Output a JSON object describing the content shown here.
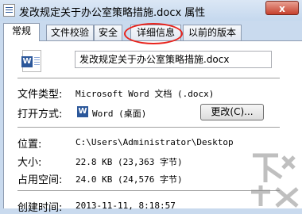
{
  "window": {
    "title": "发改规定关于办公室策略措施.docx 属性",
    "close_label": "x"
  },
  "tabs": [
    {
      "label": "常规"
    },
    {
      "label": "文件校验"
    },
    {
      "label": "安全"
    },
    {
      "label": "详细信息"
    },
    {
      "label": "以前的版本"
    }
  ],
  "active_tab": "常规",
  "file": {
    "name": "发改规定关于办公室策略措施.docx"
  },
  "fields": {
    "type_label": "文件类型:",
    "type_value": "Microsoft Word 文档 (.docx)",
    "open_label": "打开方式:",
    "open_value": "Word (桌面)",
    "change_button": "更改(C)...",
    "location_label": "位置:",
    "location_value": "C:\\Users\\Administrator\\Desktop",
    "size_label": "大小:",
    "size_value": "22.8 KB (23,363 字节)",
    "disk_label": "占用空间:",
    "disk_value": "24.0 KB (24,576 字节)",
    "created_label": "创建时间:",
    "created_value": "2013-11-11, 8:18:57"
  },
  "colors": {
    "highlight_oval": "#e8231c",
    "word_blue": "#2b579a",
    "titlebar": "#c9daee"
  },
  "icons": [
    "word-document-icon",
    "word-app-icon",
    "close-icon",
    "watermark-logo"
  ]
}
